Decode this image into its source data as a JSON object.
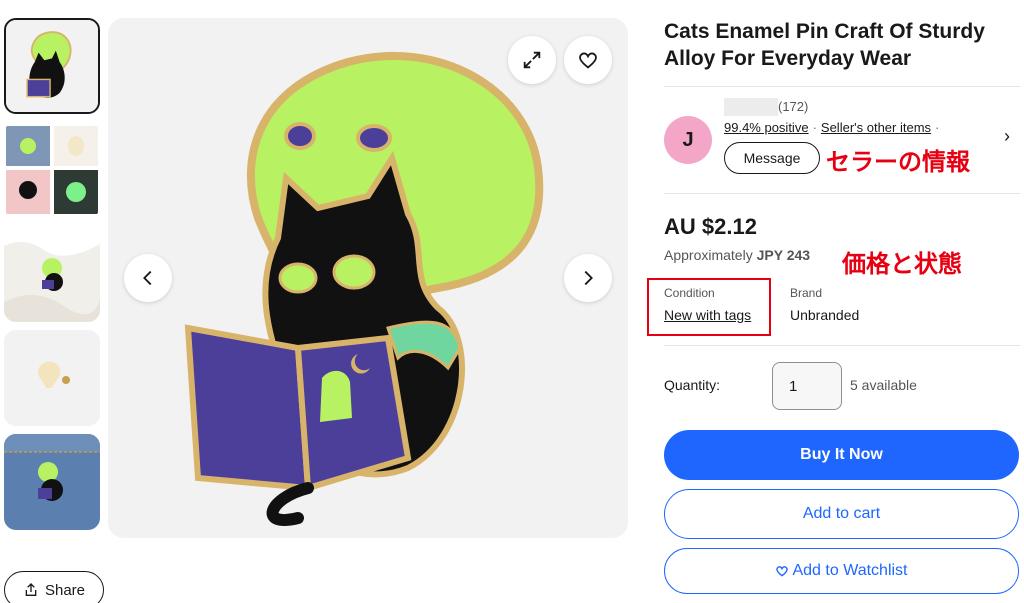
{
  "gallery": {
    "thumbnails": [
      "cat-pin-front",
      "pin-collage",
      "pin-on-fabric",
      "pin-back",
      "pin-on-denim"
    ],
    "expand_icon": "expand-icon",
    "favorite_icon": "heart-icon",
    "prev_icon": "chevron-left-icon",
    "next_icon": "chevron-right-icon"
  },
  "share": {
    "label": "Share"
  },
  "product": {
    "title": "Cats Enamel Pin Craft Of Sturdy Alloy For Everyday Wear"
  },
  "seller": {
    "avatar_letter": "J",
    "feedback_count": "(172)",
    "positive": "99.4% positive",
    "other_items": "Seller's other items",
    "message_label": "Message",
    "annotation": "セラーの情報"
  },
  "price": {
    "amount": "AU $2.12",
    "approx_prefix": "Approximately",
    "approx_value": "JPY 243",
    "annotation": "価格と状態"
  },
  "specs": {
    "condition_label": "Condition",
    "condition_value": "New with tags",
    "brand_label": "Brand",
    "brand_value": "Unbranded"
  },
  "quantity": {
    "label": "Quantity:",
    "value": "1",
    "available": "5 available"
  },
  "actions": {
    "buy_now": "Buy It Now",
    "add_to_cart": "Add to cart",
    "watchlist": "Add to Watchlist"
  },
  "colors": {
    "accent": "#1f66ff",
    "annotation_red": "#e60012",
    "avatar_bg": "#f4a6c9",
    "pin_green": "#b8f262",
    "pin_purple": "#4b3f9a"
  }
}
